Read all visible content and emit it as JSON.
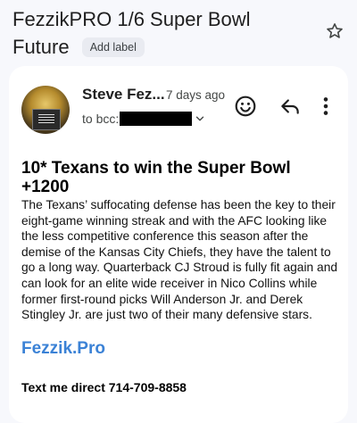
{
  "subject": {
    "line1": "FezzikPRO 1/6 Super Bowl",
    "line2": "Future",
    "add_label": "Add label"
  },
  "icons": {
    "star": "star-outline-icon",
    "emoji": "emoji-reaction-icon",
    "reply": "reply-icon",
    "more": "more-vert-icon",
    "expand": "chevron-down-icon"
  },
  "message": {
    "sender": "Steve Fez...",
    "time": "7 days ago",
    "to_prefix": "to bcc:",
    "headline": "10* Texans to win the Super Bowl +1200",
    "paragraph": "The Texans’ suffocating defense has been the key to their eight-game winning streak and with the AFC looking like the less competitive conference this season after the demise of the Kansas City Chiefs, they have the talent to go a long way. Quarterback CJ Stroud is fully fit again and can look for an elite wide receiver in Nico Collins while former first-round picks Will Anderson Jr. and Derek Stingley Jr. are just two of their many defensive stars.",
    "link": "Fezzik.Pro",
    "contact": "Text me direct 714-709-8858"
  },
  "colors": {
    "background": "#f7f8fc",
    "card": "#ffffff",
    "link": "#3b82d6",
    "chip": "#e9ebf1"
  }
}
